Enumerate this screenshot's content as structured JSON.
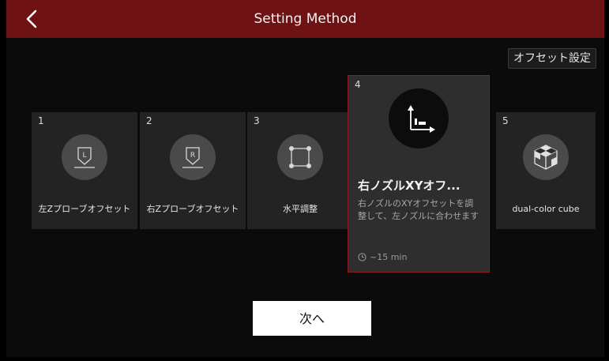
{
  "header": {
    "title": "Setting Method",
    "back_icon": "chevron-left-icon",
    "background": "#6e1213"
  },
  "offset_button": "オフセット設定",
  "methods": [
    {
      "number": "1",
      "label": "左Zプローブオフセット",
      "icon": "left-nozzle-probe-icon"
    },
    {
      "number": "2",
      "label": "右Zプローブオフセット",
      "icon": "right-nozzle-probe-icon"
    },
    {
      "number": "3",
      "label": "水平調整",
      "icon": "leveling-square-icon"
    },
    {
      "number": "4",
      "title": "右ノズルXYオフ...",
      "description": "右ノズルのXYオフセットを調整して、左ノズルに合わせます",
      "time": "~15 min",
      "icon": "xy-axes-icon",
      "selected": true
    },
    {
      "number": "5",
      "label": "dual-color cube",
      "icon": "cube-icon"
    }
  ],
  "next_button": "次へ",
  "accent_color": "#8f1c1c"
}
